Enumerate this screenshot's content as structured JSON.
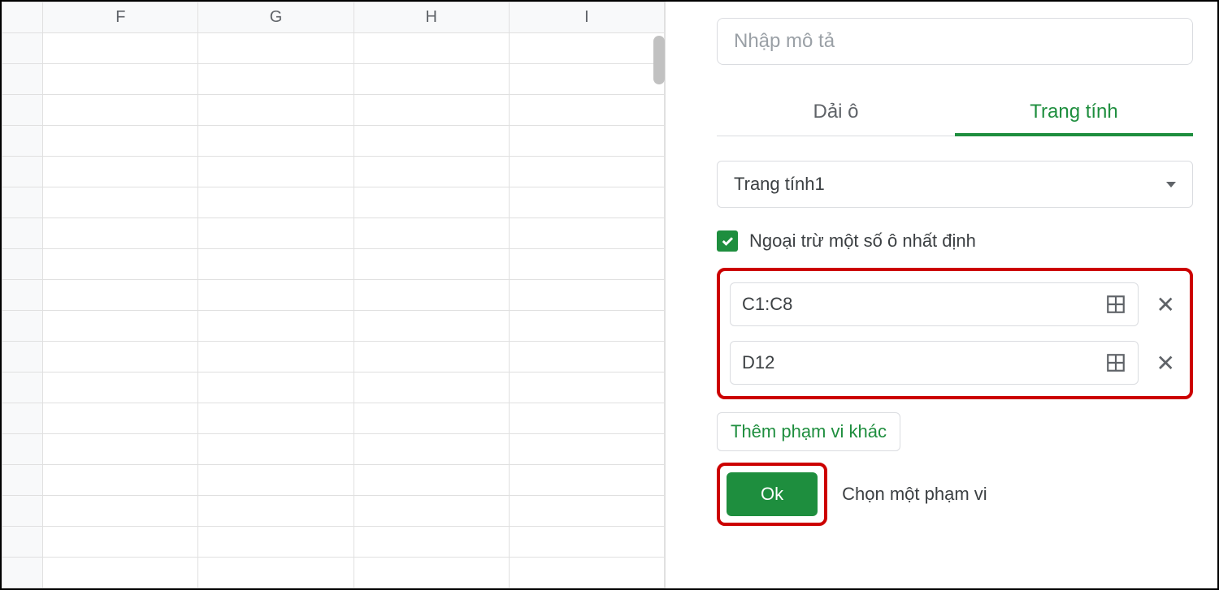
{
  "spreadsheet": {
    "columns": [
      "F",
      "G",
      "H",
      "I"
    ]
  },
  "sidebar": {
    "description_placeholder": "Nhập mô tả",
    "tabs": {
      "range": "Dải ô",
      "sheet": "Trang tính"
    },
    "sheet_select": "Trang tính1",
    "checkbox_label": "Ngoại trừ một số ô nhất định",
    "ranges": [
      {
        "value": "C1:C8"
      },
      {
        "value": "D12"
      }
    ],
    "add_range": "Thêm phạm vi khác",
    "ok": "Ok",
    "choose_range": "Chọn một phạm vi"
  }
}
